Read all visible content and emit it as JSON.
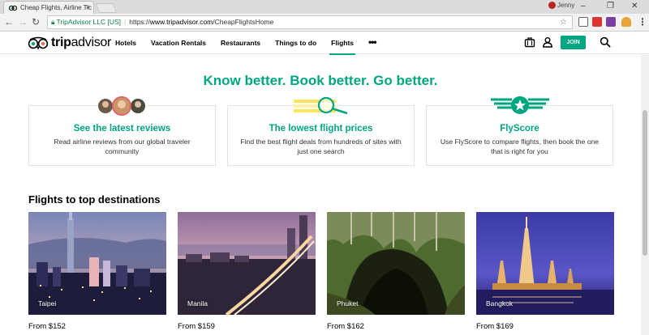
{
  "browser": {
    "tab_title": "Cheap Flights, Airline Tic",
    "user_name": "Jenny",
    "org": "TripAdvisor LLC [US]",
    "url_scheme": "https://",
    "url_host": "www.tripadvisor.com",
    "url_path": "/CheapFlightsHome"
  },
  "site": {
    "logo_text_bold": "trip",
    "logo_text_light": "advisor",
    "nav": [
      {
        "label": "Hotels"
      },
      {
        "label": "Vacation Rentals"
      },
      {
        "label": "Restaurants"
      },
      {
        "label": "Things to do"
      },
      {
        "label": "Flights",
        "active": true
      }
    ],
    "more_label": "•••",
    "join_label": "JOIN",
    "accent_color": "#00a680"
  },
  "hero": {
    "tagline": "Know better. Book better. Go better."
  },
  "features": [
    {
      "title": "See the latest reviews",
      "desc": "Read airline reviews from our global traveler community"
    },
    {
      "title": "The lowest flight prices",
      "desc": "Find the best flight deals from hundreds of sites with just one search"
    },
    {
      "title": "FlyScore",
      "desc": "Use FlyScore to compare flights, then book the one that is right for you"
    }
  ],
  "destinations_section": {
    "title": "Flights to top destinations",
    "items": [
      {
        "name": "Taipei",
        "price": "From $152"
      },
      {
        "name": "Manila",
        "price": "From $159"
      },
      {
        "name": "Phuket",
        "price": "From $162"
      },
      {
        "name": "Bangkok",
        "price": "From $169"
      }
    ]
  }
}
